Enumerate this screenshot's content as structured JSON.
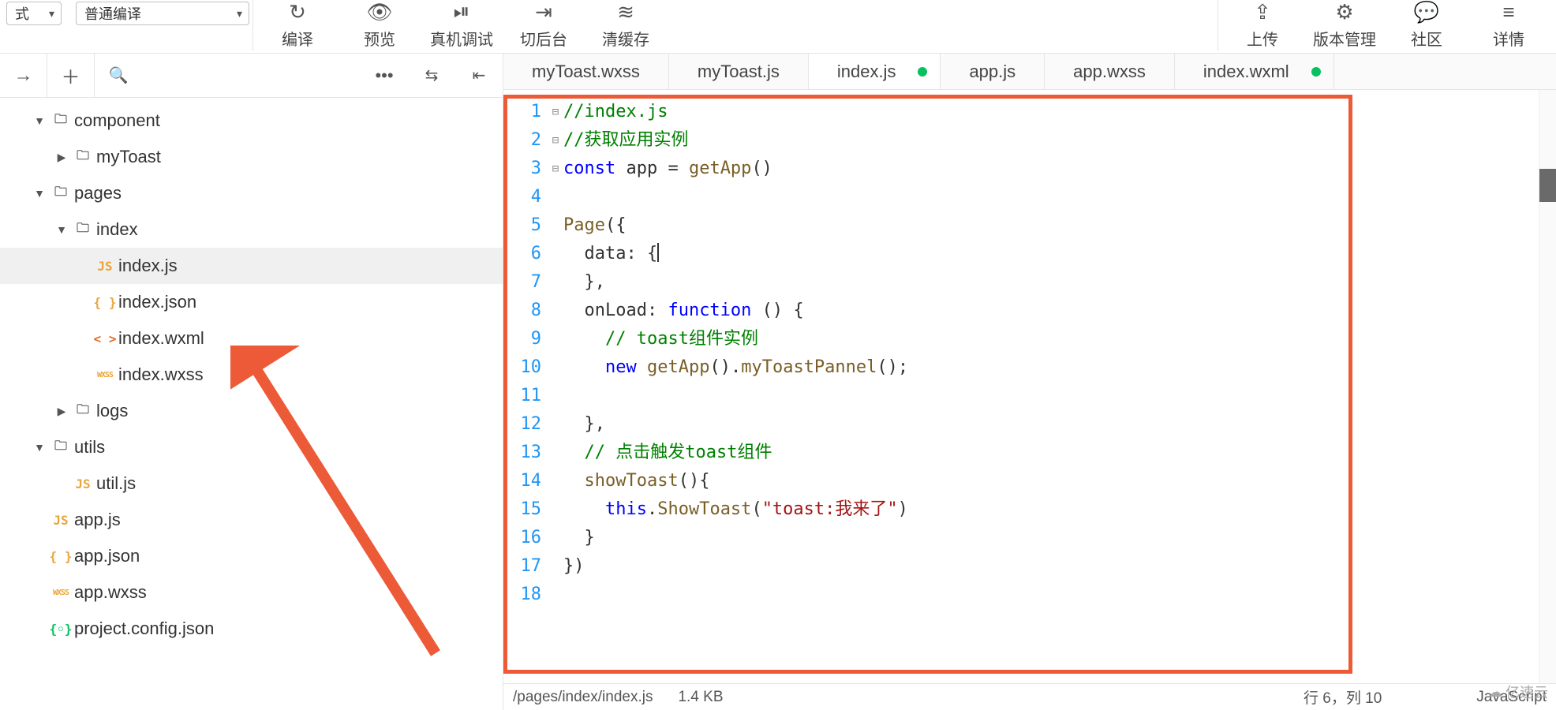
{
  "toolbar": {
    "dropdown1_label": "式",
    "dropdown2_label": "普通编译",
    "actions": [
      {
        "icon": "↻",
        "label": "编译"
      },
      {
        "icon": "👁",
        "label": "预览"
      },
      {
        "icon": "⏯",
        "label": "真机调试"
      },
      {
        "icon": "⇥",
        "label": "切后台"
      },
      {
        "icon": "≋",
        "label": "清缓存"
      }
    ],
    "right_actions": [
      {
        "icon": "⇪",
        "label": "上传"
      },
      {
        "icon": "⚙",
        "label": "版本管理"
      },
      {
        "icon": "💬",
        "label": "社区"
      },
      {
        "icon": "≡",
        "label": "详情"
      }
    ]
  },
  "sidebar_icons": {
    "arrow": "→",
    "plus": "＋",
    "search": "🔍",
    "more": "•••",
    "collapse": "⇆",
    "outdent": "⇤"
  },
  "tabs": [
    {
      "label": "myToast.wxss",
      "active": false,
      "dirty": false
    },
    {
      "label": "myToast.js",
      "active": false,
      "dirty": false
    },
    {
      "label": "index.js",
      "active": true,
      "dirty": true
    },
    {
      "label": "app.js",
      "active": false,
      "dirty": false
    },
    {
      "label": "app.wxss",
      "active": false,
      "dirty": false
    },
    {
      "label": "index.wxml",
      "active": false,
      "dirty": true
    }
  ],
  "tree": [
    {
      "depth": 0,
      "kind": "folder",
      "open": true,
      "label": "component"
    },
    {
      "depth": 1,
      "kind": "folder",
      "open": false,
      "label": "myToast"
    },
    {
      "depth": 0,
      "kind": "folder",
      "open": true,
      "label": "pages"
    },
    {
      "depth": 1,
      "kind": "folder",
      "open": true,
      "label": "index"
    },
    {
      "depth": 2,
      "kind": "js",
      "label": "index.js",
      "selected": true
    },
    {
      "depth": 2,
      "kind": "json",
      "label": "index.json"
    },
    {
      "depth": 2,
      "kind": "wxml",
      "label": "index.wxml"
    },
    {
      "depth": 2,
      "kind": "wxss",
      "label": "index.wxss"
    },
    {
      "depth": 1,
      "kind": "folder",
      "open": false,
      "label": "logs"
    },
    {
      "depth": 0,
      "kind": "folder",
      "open": true,
      "label": "utils"
    },
    {
      "depth": 1,
      "kind": "js",
      "label": "util.js"
    },
    {
      "depth": 0,
      "kind": "js",
      "label": "app.js"
    },
    {
      "depth": 0,
      "kind": "json",
      "label": "app.json"
    },
    {
      "depth": 0,
      "kind": "wxss",
      "label": "app.wxss"
    },
    {
      "depth": 0,
      "kind": "cfg",
      "label": "project.config.json"
    }
  ],
  "code": [
    {
      "n": 1,
      "fold": "",
      "spans": [
        {
          "c": "c-cmt",
          "t": "//index.js"
        }
      ]
    },
    {
      "n": 2,
      "fold": "",
      "spans": [
        {
          "c": "c-cmt",
          "t": "//获取应用实例"
        }
      ]
    },
    {
      "n": 3,
      "fold": "",
      "spans": [
        {
          "c": "c-kw",
          "t": "const"
        },
        {
          "c": "",
          "t": " app = "
        },
        {
          "c": "c-fn",
          "t": "getApp"
        },
        {
          "c": "",
          "t": "()"
        }
      ]
    },
    {
      "n": 4,
      "fold": "",
      "spans": []
    },
    {
      "n": 5,
      "fold": "⊟",
      "spans": [
        {
          "c": "c-fn",
          "t": "Page"
        },
        {
          "c": "",
          "t": "({"
        }
      ]
    },
    {
      "n": 6,
      "fold": "",
      "spans": [
        {
          "c": "",
          "t": "  data: {"
        },
        {
          "cursor": true
        }
      ]
    },
    {
      "n": 7,
      "fold": "",
      "spans": [
        {
          "c": "",
          "t": "  },"
        }
      ]
    },
    {
      "n": 8,
      "fold": "⊟",
      "spans": [
        {
          "c": "",
          "t": "  onLoad: "
        },
        {
          "c": "c-kw",
          "t": "function"
        },
        {
          "c": "",
          "t": " () {"
        }
      ]
    },
    {
      "n": 9,
      "fold": "",
      "spans": [
        {
          "c": "",
          "t": "    "
        },
        {
          "c": "c-cmt",
          "t": "// toast组件实例"
        }
      ]
    },
    {
      "n": 10,
      "fold": "",
      "spans": [
        {
          "c": "",
          "t": "    "
        },
        {
          "c": "c-kw",
          "t": "new"
        },
        {
          "c": "",
          "t": " "
        },
        {
          "c": "c-fn",
          "t": "getApp"
        },
        {
          "c": "",
          "t": "()."
        },
        {
          "c": "c-fn",
          "t": "myToastPannel"
        },
        {
          "c": "",
          "t": "();"
        }
      ]
    },
    {
      "n": 11,
      "fold": "",
      "spans": []
    },
    {
      "n": 12,
      "fold": "",
      "spans": [
        {
          "c": "",
          "t": "  },"
        }
      ]
    },
    {
      "n": 13,
      "fold": "",
      "spans": [
        {
          "c": "",
          "t": "  "
        },
        {
          "c": "c-cmt",
          "t": "// 点击触发toast组件"
        }
      ]
    },
    {
      "n": 14,
      "fold": "⊟",
      "spans": [
        {
          "c": "",
          "t": "  "
        },
        {
          "c": "c-fn",
          "t": "showToast"
        },
        {
          "c": "",
          "t": "(){"
        }
      ]
    },
    {
      "n": 15,
      "fold": "",
      "spans": [
        {
          "c": "",
          "t": "    "
        },
        {
          "c": "c-kw",
          "t": "this"
        },
        {
          "c": "",
          "t": "."
        },
        {
          "c": "c-fn",
          "t": "ShowToast"
        },
        {
          "c": "",
          "t": "("
        },
        {
          "c": "c-str",
          "t": "\"toast:我来了\""
        },
        {
          "c": "",
          "t": ")"
        }
      ]
    },
    {
      "n": 16,
      "fold": "",
      "spans": [
        {
          "c": "",
          "t": "  }"
        }
      ]
    },
    {
      "n": 17,
      "fold": "",
      "spans": [
        {
          "c": "",
          "t": "})"
        }
      ]
    },
    {
      "n": 18,
      "fold": "",
      "spans": []
    }
  ],
  "status": {
    "path": "/pages/index/index.js",
    "size": "1.4 KB",
    "cursor": "行 6，列 10",
    "lang": "JavaScript"
  },
  "watermark": "亿速云"
}
